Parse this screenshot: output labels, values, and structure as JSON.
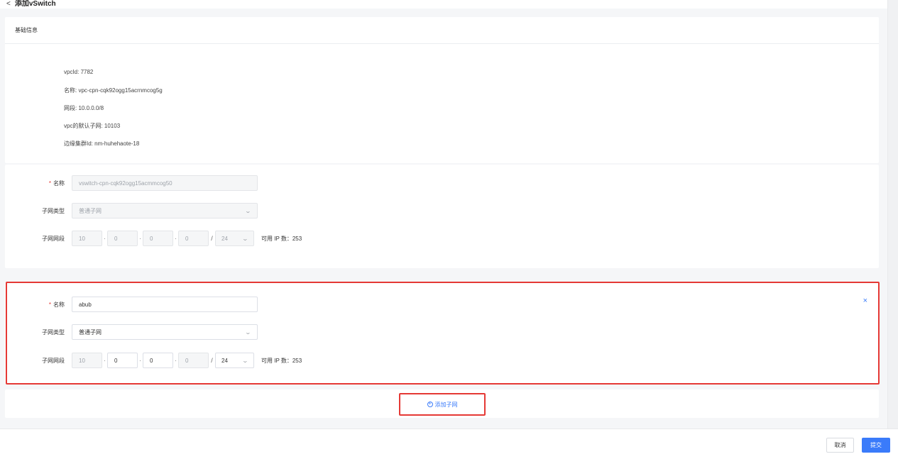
{
  "header": {
    "title": "添加vSwitch",
    "back_icon": "<"
  },
  "basic_info": {
    "section_title": "基础信息",
    "rows": [
      "vpcId: 7782",
      "名称: vpc-cpn-cqk92ogg15acrnmcog5g",
      "网段: 10.0.0.0/8",
      "vpc的默认子网: 10103",
      "边缘集群Id: nm-huhehaote-18"
    ]
  },
  "subnet_default": {
    "required_mark": "*",
    "name_label": "名称",
    "name_value": "vswitch-cpn-cqk92ogg15acmmcog50",
    "type_label": "子网类型",
    "type_value": "普通子网",
    "cidr_label": "子网网段",
    "octets": [
      "10",
      "0",
      "0",
      "0"
    ],
    "dot": "·",
    "slash": "/",
    "mask": "24",
    "ip_count": "可用 IP 数：253"
  },
  "subnet_new": {
    "required_mark": "*",
    "name_label": "名称",
    "name_value": "abub",
    "type_label": "子网类型",
    "type_value": "普通子网",
    "cidr_label": "子网网段",
    "octets": [
      "10",
      "0",
      "0",
      "0"
    ],
    "dot": "·",
    "slash": "/",
    "mask": "24",
    "ip_count": "可用 IP 数：253",
    "close_icon": "×"
  },
  "add_subnet": {
    "label": "添加子网",
    "icon": "+"
  },
  "footer": {
    "cancel_label": "取消",
    "submit_label": "提交"
  },
  "colors": {
    "accent": "#3a7bfa",
    "highlight": "#e53935",
    "required": "#e53935"
  }
}
